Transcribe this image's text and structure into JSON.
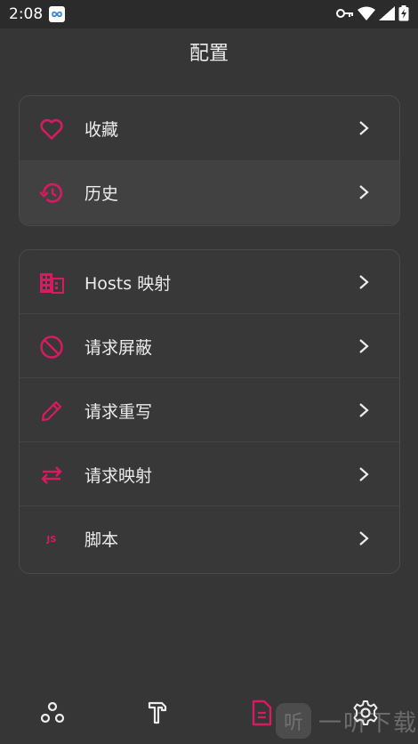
{
  "status_bar": {
    "time": "2:08",
    "icons": [
      "app-notification-icon",
      "key-icon",
      "wifi-icon",
      "signal-icon",
      "battery-charging-icon"
    ]
  },
  "page": {
    "title": "配置"
  },
  "colors": {
    "accent": "#d81b60",
    "background": "#363636",
    "text": "#ececec"
  },
  "group1": {
    "items": [
      {
        "label": "收藏",
        "icon": "heart-icon"
      },
      {
        "label": "历史",
        "icon": "history-icon"
      }
    ]
  },
  "group2": {
    "items": [
      {
        "label": "Hosts 映射",
        "icon": "building-icon"
      },
      {
        "label": "请求屏蔽",
        "icon": "block-icon"
      },
      {
        "label": "请求重写",
        "icon": "pencil-icon"
      },
      {
        "label": "请求映射",
        "icon": "swap-arrows-icon"
      },
      {
        "label": "脚本",
        "icon": "js-icon",
        "icon_text": "JS"
      }
    ]
  },
  "bottom_nav": {
    "items": [
      {
        "icon": "nodes-icon"
      },
      {
        "icon": "hammer-icon"
      },
      {
        "icon": "document-icon",
        "active": true
      },
      {
        "icon": "settings-gear-icon"
      }
    ]
  },
  "watermark": {
    "badge": "听",
    "text": "一听下载"
  }
}
